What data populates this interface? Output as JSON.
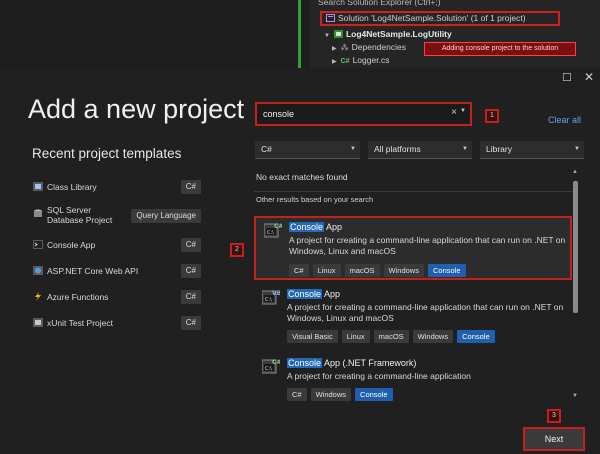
{
  "solution_explorer": {
    "search_placeholder": "Search Solution Explorer (Ctrl+;)",
    "solution_label": "Solution 'Log4NetSample.Solution' (1 of 1 project)",
    "project_label": "Log4NetSample.LogUtility",
    "dependencies_label": "Dependencies",
    "logger_label": "Logger.cs",
    "annotation": "Adding console project to the solution"
  },
  "dialog": {
    "title": "Add a new project",
    "maximize_icon": "square-icon",
    "close_icon": "close-icon"
  },
  "recent": {
    "heading": "Recent project templates",
    "items": [
      {
        "label": "Class Library",
        "badge": "C#",
        "icon": "class-library-icon"
      },
      {
        "label": "SQL Server\nDatabase Project",
        "badge": "Query Language",
        "icon": "database-project-icon"
      },
      {
        "label": "Console App",
        "badge": "C#",
        "icon": "console-app-icon"
      },
      {
        "label": "ASP.NET Core Web API",
        "badge": "C#",
        "icon": "web-api-icon"
      },
      {
        "label": "Azure Functions",
        "badge": "C#",
        "icon": "azure-functions-icon"
      },
      {
        "label": "xUnit Test Project",
        "badge": "C#",
        "icon": "test-project-icon"
      }
    ]
  },
  "search": {
    "value": "console",
    "clear_icon": "×",
    "step_label": "1"
  },
  "clear_all": "Clear all",
  "filters": {
    "language": "C#",
    "platform": "All platforms",
    "project_type": "Library"
  },
  "results": {
    "no_exact": "No exact matches found",
    "other": "Other results based on your search",
    "step_label": "2",
    "items": [
      {
        "highlight": "Console",
        "title_rest": " App",
        "lang": "C#",
        "description": "A project for creating a command-line application that can run on .NET on Windows, Linux and macOS",
        "tags": [
          "C#",
          "Linux",
          "macOS",
          "Windows",
          "Console"
        ]
      },
      {
        "highlight": "Console",
        "title_rest": " App",
        "lang": "VB",
        "description": "A project for creating a command-line application that can run on .NET on Windows, Linux and macOS",
        "tags": [
          "Visual Basic",
          "Linux",
          "macOS",
          "Windows",
          "Console"
        ]
      },
      {
        "highlight": "Console",
        "title_rest": " App (.NET Framework)",
        "lang": "C#",
        "description": "A project for creating a command-line application",
        "tags": [
          "C#",
          "Windows",
          "Console"
        ]
      }
    ]
  },
  "next": {
    "label": "Next",
    "step_label": "3"
  },
  "colors": {
    "accent_red": "#c42020",
    "highlight_blue": "#2668b8",
    "link_blue": "#5fa8e8"
  }
}
